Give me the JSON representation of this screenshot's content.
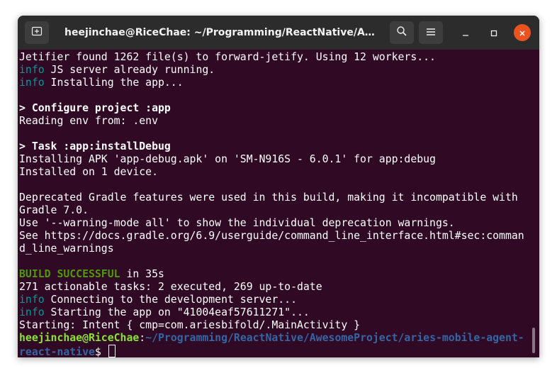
{
  "window": {
    "title": "heejinchae@RiceChae: ~/Programming/ReactNative/Aweso..."
  },
  "titlebar": {
    "new_tab_icon": "new-tab-icon",
    "search_icon": "search-icon",
    "menu_icon": "hamburger-menu-icon",
    "minimize_icon": "minimize-icon",
    "maximize_icon": "maximize-icon",
    "close_icon": "close-icon"
  },
  "colors": {
    "background": "#300a24",
    "titlebar": "#2c2c2c",
    "info": "#06989a",
    "success": "#4e9a06",
    "prompt_user": "#8ae234",
    "prompt_path": "#3465a4",
    "close": "#e95420"
  },
  "terminal": {
    "l1": "Jetifier found 1262 file(s) to forward-jetify. Using 12 workers...",
    "l2_tag": "info",
    "l2_text": " JS server already running.",
    "l3_tag": "info",
    "l3_text": " Installing the app...",
    "l4": "",
    "l5": "> Configure project :app",
    "l6": "Reading env from: .env",
    "l7": "",
    "l8": "> Task :app:installDebug",
    "l9": "Installing APK 'app-debug.apk' on 'SM-N916S - 6.0.1' for app:debug",
    "l10": "Installed on 1 device.",
    "l11": "",
    "l12": "Deprecated Gradle features were used in this build, making it incompatible with",
    "l13": "Gradle 7.0.",
    "l14": "Use '--warning-mode all' to show the individual deprecation warnings.",
    "l15": "See https://docs.gradle.org/6.9/userguide/command_line_interface.html#sec:comman",
    "l16": "d_line_warnings",
    "l17": "",
    "l18_tag": "BUILD SUCCESSFUL",
    "l18_text": " in 35s",
    "l19": "271 actionable tasks: 2 executed, 269 up-to-date",
    "l20_tag": "info",
    "l20_text": " Connecting to the development server...",
    "l21_tag": "info",
    "l21_text": " Starting the app on \"41004eaf57611271\"...",
    "l22": "Starting: Intent { cmp=com.ariesbifold/.MainActivity }",
    "prompt_user": "heejinchae@RiceChae",
    "prompt_colon": ":",
    "prompt_path_1": "~/Programming/ReactNative/AwesomeProject/aries-mobile-agent-",
    "prompt_path_2": "react-native",
    "prompt_symbol": "$ "
  }
}
